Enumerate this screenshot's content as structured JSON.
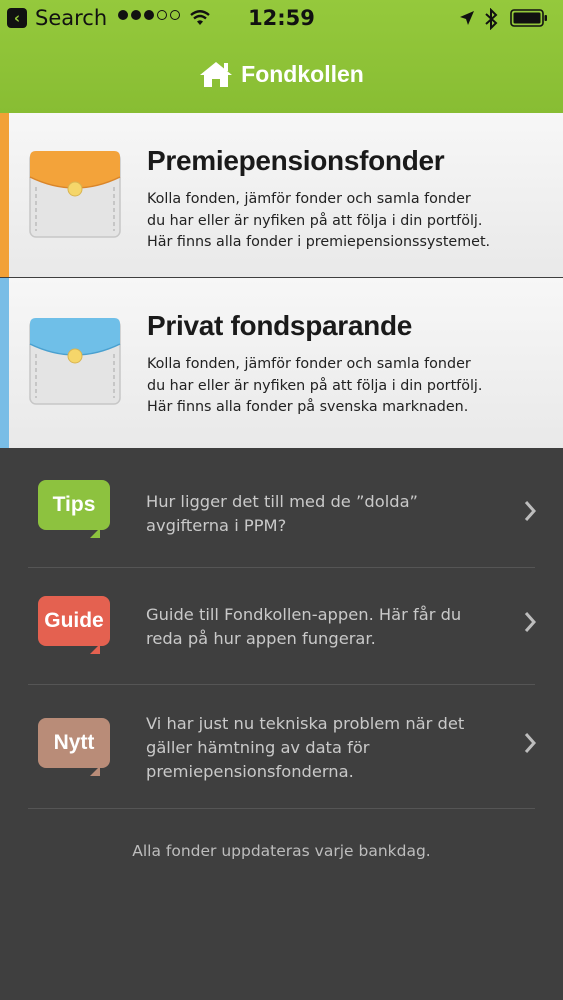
{
  "status_bar": {
    "back_label": "Search",
    "time": "12:59"
  },
  "header": {
    "title": "Fondkollen",
    "icon": "home-icon"
  },
  "cards": [
    {
      "title": "Premiepensionsfonder",
      "description_lines": [
        "Kolla fonden, jämför fonder och samla fonder",
        "du har eller är nyfiken på att följa i din portfölj.",
        "Här finns alla fonder i premiepensionssystemet."
      ],
      "accent_color": "#f2a137",
      "icon": "wallet-orange-icon"
    },
    {
      "title": "Privat fondsparande",
      "description_lines": [
        "Kolla fonden, jämför fonder och samla fonder",
        "du har eller är nyfiken på att följa i din portfölj.",
        "Här finns alla fonder på svenska marknaden."
      ],
      "accent_color": "#79bde6",
      "icon": "wallet-blue-icon"
    }
  ],
  "news_items": [
    {
      "badge": "Tips",
      "badge_color": "#8dc23f",
      "text_lines": [
        "Hur ligger det till med de ”dolda”",
        "avgifterna i PPM?"
      ]
    },
    {
      "badge": "Guide",
      "badge_color": "#e46150",
      "text_lines": [
        "Guide till Fondkollen-appen. Här får du",
        "reda på hur appen fungerar."
      ]
    },
    {
      "badge": "Nytt",
      "badge_color": "#b98c78",
      "text_lines": [
        "Vi har just nu tekniska problem när det",
        "gäller hämtning av data för",
        "premiepensionsfonderna."
      ]
    }
  ],
  "footer": {
    "text": "Alla fonder uppdateras varje bankdag."
  }
}
